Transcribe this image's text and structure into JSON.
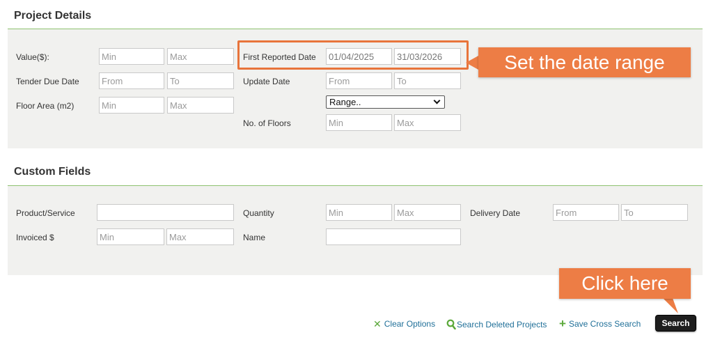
{
  "project_details": {
    "title": "Project Details",
    "value": {
      "label": "Value($):",
      "min_placeholder": "Min",
      "max_placeholder": "Max"
    },
    "tender_due_date": {
      "label": "Tender Due Date",
      "from_placeholder": "From",
      "to_placeholder": "To"
    },
    "floor_area": {
      "label": "Floor Area (m2)",
      "min_placeholder": "Min",
      "max_placeholder": "Max"
    },
    "first_reported_date": {
      "label": "First Reported Date",
      "from_value": "01/04/2025",
      "to_value": "31/03/2026"
    },
    "update_date": {
      "label": "Update Date",
      "from_placeholder": "From",
      "to_placeholder": "To"
    },
    "range_select": {
      "selected": "Range.."
    },
    "no_of_floors": {
      "label": "No. of Floors",
      "min_placeholder": "Min",
      "max_placeholder": "Max"
    }
  },
  "custom_fields": {
    "title": "Custom Fields",
    "product_service": {
      "label": "Product/Service",
      "value": ""
    },
    "quantity": {
      "label": "Quantity",
      "min_placeholder": "Min",
      "max_placeholder": "Max"
    },
    "delivery_date": {
      "label": "Delivery Date",
      "from_placeholder": "From",
      "to_placeholder": "To"
    },
    "invoiced": {
      "label": "Invoiced $",
      "min_placeholder": "Min",
      "max_placeholder": "Max"
    },
    "name": {
      "label": "Name",
      "value": ""
    }
  },
  "callouts": {
    "date_range": "Set the date range",
    "click_here": "Click here"
  },
  "actions": {
    "clear_options": "Clear Options",
    "search_deleted": "Search Deleted Projects",
    "save_cross_search": "Save Cross Search",
    "search": "Search"
  },
  "colors": {
    "accent_green": "#8dc26f",
    "callout_orange": "#ed7d45",
    "link_blue": "#1f6f98",
    "panel_bg": "#f1f1ef"
  }
}
